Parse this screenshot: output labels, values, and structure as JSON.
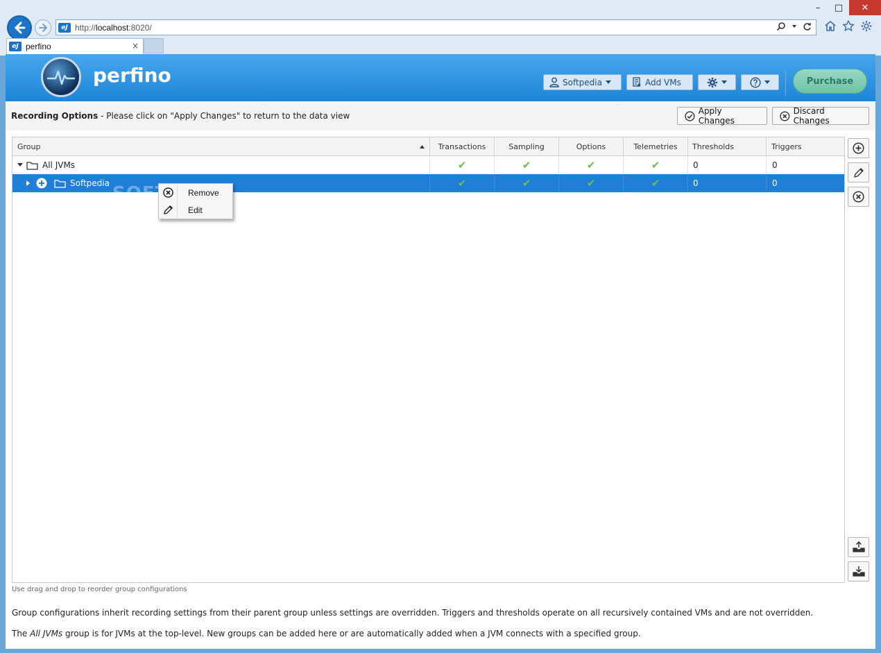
{
  "browser": {
    "url_prefix": "http://",
    "url_host": "localhost",
    "url_suffix": ":8020/",
    "favicon_text": "eJ",
    "tab_title": "perfino",
    "tab_close": "×",
    "window_controls": {
      "minimize": "–",
      "maximize": "□",
      "close": "✕"
    }
  },
  "header": {
    "brand": "perfino",
    "user_button": "Softpedia",
    "add_vms_button": "Add VMs",
    "purchase_button": "Purchase"
  },
  "options_bar": {
    "title": "Recording Options",
    "message": " - Please click on \"Apply Changes\" to return to the data view",
    "apply_button": "Apply Changes",
    "discard_button": "Discard Changes"
  },
  "grid": {
    "columns": [
      "Group",
      "Transactions",
      "Sampling",
      "Options",
      "Telemetries",
      "Thresholds",
      "Triggers"
    ],
    "check_glyph": "✔",
    "rows": [
      {
        "name": "All JVMs",
        "transactions": "✔",
        "sampling": "✔",
        "options": "✔",
        "telemetries": "✔",
        "thresholds": "0",
        "triggers": "0",
        "selected": false
      },
      {
        "name": "Softpedia",
        "transactions": "✔",
        "sampling": "✔",
        "options": "✔",
        "telemetries": "✔",
        "thresholds": "0",
        "triggers": "0",
        "selected": true
      }
    ]
  },
  "context_menu": {
    "items": [
      "Remove",
      "Edit"
    ]
  },
  "watermark": "SOFTPEDIA",
  "footer": {
    "hint": "Use drag and drop to reorder group configurations",
    "info1": "Group configurations inherit recording settings from their parent group unless settings are overridden. Triggers and thresholds operate on all recursively contained VMs and are not overridden.",
    "info2_prefix": "The ",
    "info2_em": "All JVMs",
    "info2_suffix": " group is for JVMs at the top-level. New groups can be added here or are automatically added when a JVM connects with a specified group."
  },
  "colors": {
    "header_blue": "#1d86d8",
    "selection_blue": "#1f7fd6",
    "check_green": "#6cc04a",
    "purchase_green": "#6cc2a4"
  }
}
